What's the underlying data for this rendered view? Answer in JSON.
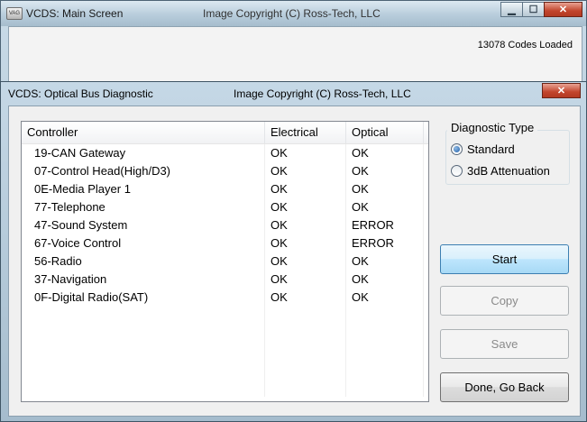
{
  "main_window": {
    "title": "VCDS:  Main Screen",
    "copyright": "Image Copyright (C) Ross-Tech, LLC",
    "codes_loaded": "13078 Codes Loaded"
  },
  "dialog": {
    "title": "VCDS:  Optical Bus Diagnostic",
    "copyright": "Image Copyright (C) Ross-Tech, LLC",
    "table": {
      "headers": [
        "Controller",
        "Electrical",
        "Optical"
      ],
      "rows": [
        [
          "19-CAN Gateway",
          "OK",
          "OK"
        ],
        [
          "07-Control Head(High/D3)",
          "OK",
          "OK"
        ],
        [
          "0E-Media Player 1",
          "OK",
          "OK"
        ],
        [
          "77-Telephone",
          "OK",
          "OK"
        ],
        [
          "47-Sound System",
          "OK",
          "ERROR"
        ],
        [
          "67-Voice Control",
          "OK",
          "ERROR"
        ],
        [
          "56-Radio",
          "OK",
          "OK"
        ],
        [
          "37-Navigation",
          "OK",
          "OK"
        ],
        [
          "0F-Digital Radio(SAT)",
          "OK",
          "OK"
        ]
      ],
      "empty_rows": 5
    },
    "diagnostic_type": {
      "label": "Diagnostic Type",
      "options": [
        "Standard",
        "3dB Attenuation"
      ],
      "selected": "Standard"
    },
    "buttons": {
      "start": "Start",
      "copy": "Copy",
      "save": "Save",
      "done": "Done, Go Back"
    }
  },
  "icons": {
    "app": "vcds-app-icon",
    "minimize": "minimize-icon",
    "maximize": "maximize-icon",
    "close": "close-icon"
  }
}
